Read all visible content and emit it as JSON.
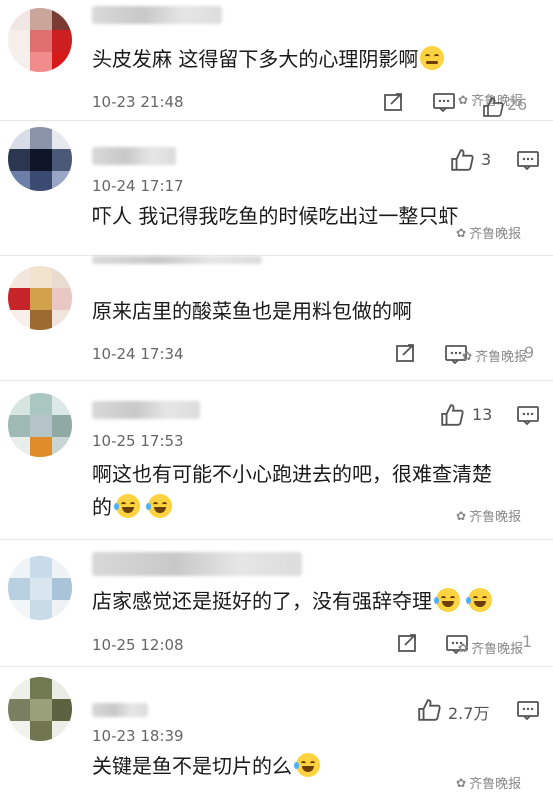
{
  "watermark": "齐鲁晚报",
  "comments": [
    {
      "text": "头皮发麻 这得留下多大的心理阴影啊",
      "emoji": "embarrassed-emoji",
      "time": "10-23 21:48",
      "likes": "",
      "like_visible": "26"
    },
    {
      "text": "吓人 我记得我吃鱼的时候吃出过一整只虾",
      "time": "10-24 17:17",
      "likes": "3"
    },
    {
      "text": "原来店里的酸菜鱼也是用料包做的啊",
      "time": "10-24 17:34",
      "likes": "9"
    },
    {
      "text_line1": "啊这也有可能不小心跑进去的吧，很难查清楚",
      "text_line2": "的",
      "time": "10-25 17:53",
      "likes": "13"
    },
    {
      "text": "店家感觉还是挺好的了，没有强辞夺理",
      "time": "10-25 12:08",
      "likes": "1"
    },
    {
      "text": "关键是鱼不是切片的么",
      "time": "10-23 18:39",
      "likes": "2.7万"
    }
  ],
  "colors": {
    "text": "#1a1a1a",
    "meta": "#666666",
    "divider": "#e8e8e8",
    "emoji": "#ffd23f"
  }
}
